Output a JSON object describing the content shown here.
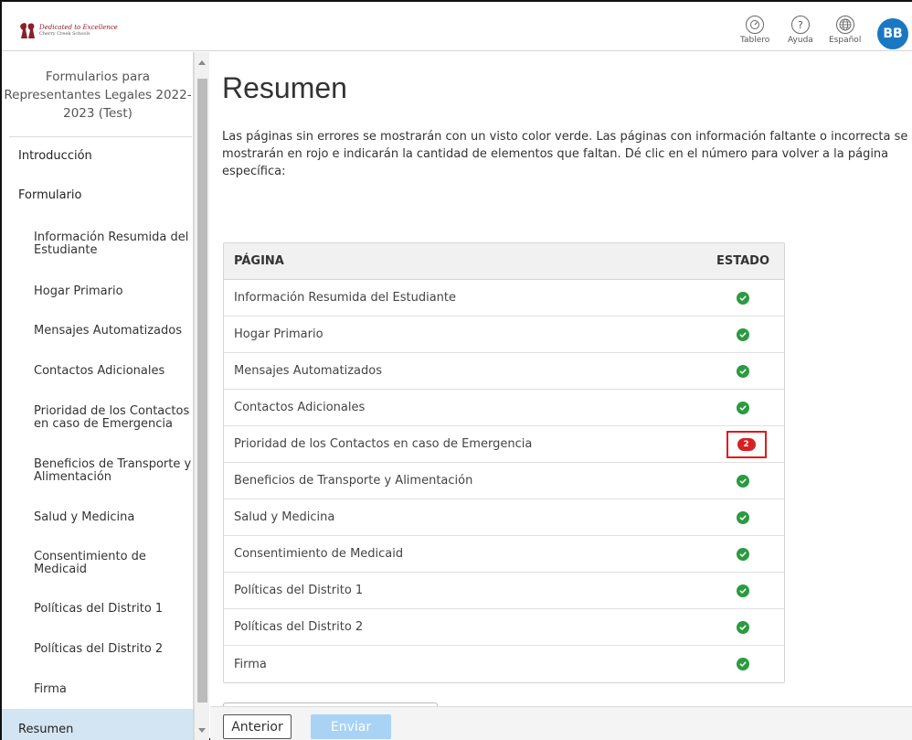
{
  "header": {
    "logo_line1": "Dedicated to Excellence",
    "logo_line2": "Cherry Creek Schools",
    "nav": [
      {
        "label": "Tablero",
        "icon": "dashboard-icon"
      },
      {
        "label": "Ayuda",
        "icon": "help-icon"
      },
      {
        "label": "Español",
        "icon": "globe-icon"
      }
    ],
    "avatar": "BB"
  },
  "sidebar": {
    "title": "Formularios para Representantes Legales 2022-2023 (Test)",
    "sections": [
      "Introducción",
      "Formulario"
    ],
    "items": [
      "Información Resumida del Estudiante",
      "Hogar Primario",
      "Mensajes Automatizados",
      "Contactos Adicionales",
      "Prioridad de los Contactos en caso de Emergencia",
      "Beneficios de Transporte y Alimentación",
      "Salud y Medicina",
      "Consentimiento de Medicaid",
      "Políticas del Distrito 1",
      "Políticas del Distrito 2",
      "Firma"
    ],
    "active": "Resumen"
  },
  "main": {
    "title": "Resumen",
    "intro": "Las páginas sin errores se mostrarán con un visto color verde. Las páginas con información faltante o incorrecta se mostrarán en rojo e indicarán la cantidad de elementos que faltan. Dé clic en el número para volver a la página específica:",
    "table": {
      "col_page": "PÁGINA",
      "col_status": "ESTADO",
      "rows": [
        {
          "page": "Información Resumida del Estudiante",
          "status": "ok"
        },
        {
          "page": "Hogar Primario",
          "status": "ok"
        },
        {
          "page": "Mensajes Automatizados",
          "status": "ok"
        },
        {
          "page": "Contactos Adicionales",
          "status": "ok"
        },
        {
          "page": "Prioridad de los Contactos en caso de Emergencia",
          "status": "error",
          "count": "2"
        },
        {
          "page": "Beneficios de Transporte y Alimentación",
          "status": "ok"
        },
        {
          "page": "Salud y Medicina",
          "status": "ok"
        },
        {
          "page": "Consentimiento de Medicaid",
          "status": "ok"
        },
        {
          "page": "Políticas del Distrito 1",
          "status": "ok"
        },
        {
          "page": "Políticas del Distrito 2",
          "status": "ok"
        },
        {
          "page": "Firma",
          "status": "ok"
        }
      ]
    }
  },
  "footer": {
    "prev_label": "Anterior",
    "send_label": "Enviar"
  },
  "colors": {
    "ok": "#2c9a41",
    "error": "#d92020",
    "active_bg": "#d3e5f3",
    "avatar": "#1a78c2",
    "send_disabled": "#a8d3f5"
  }
}
